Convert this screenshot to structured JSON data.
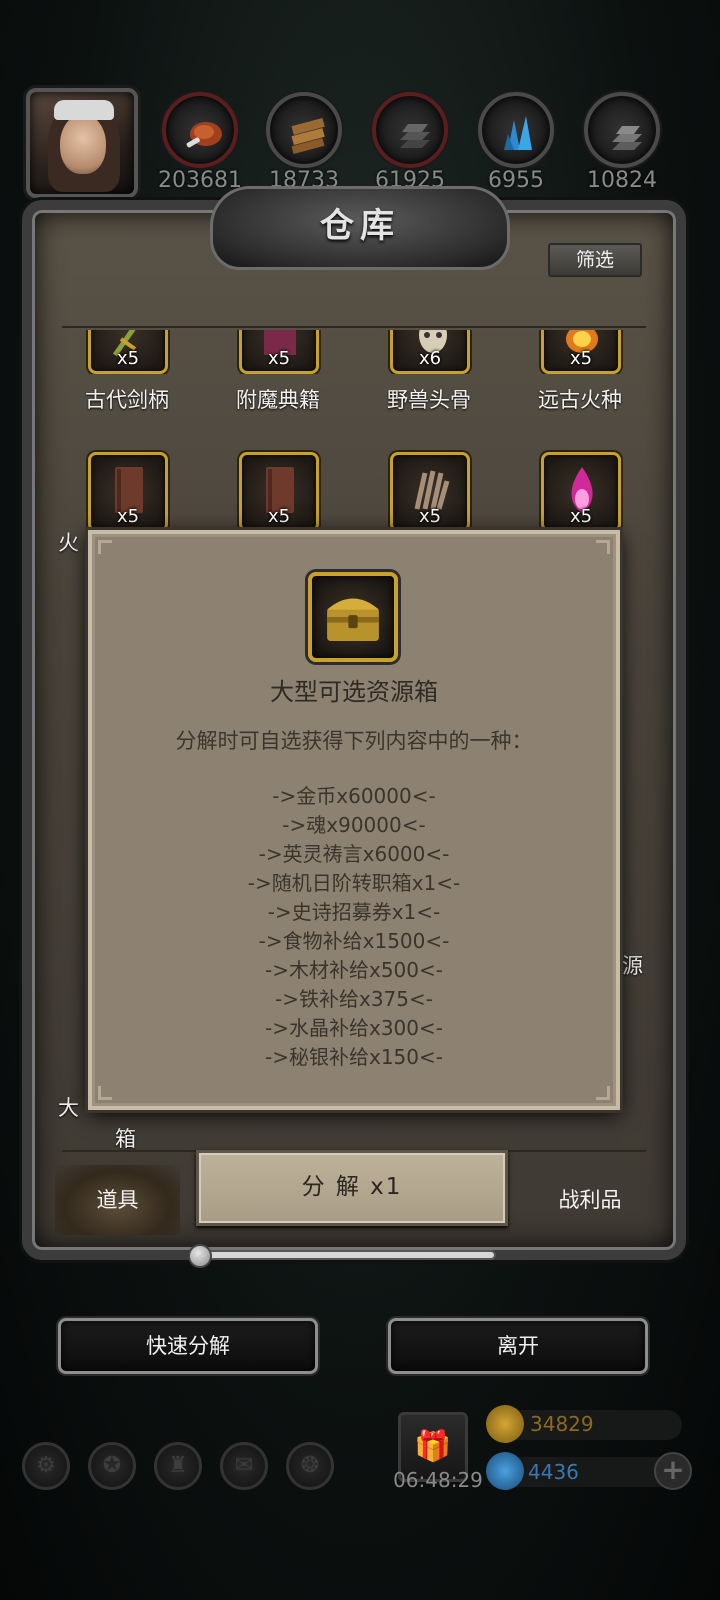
{
  "header": {
    "resources": [
      {
        "icon": "meat-icon",
        "value": "203681"
      },
      {
        "icon": "wood-icon",
        "value": "18733"
      },
      {
        "icon": "iron-icon",
        "value": "61925"
      },
      {
        "icon": "crystal-icon",
        "value": "6955"
      },
      {
        "icon": "mithril-icon",
        "value": "10824"
      }
    ]
  },
  "window": {
    "title": "仓库",
    "filter_label": "筛选",
    "items_row1": [
      {
        "name": "古代剑柄",
        "qty": "x5",
        "icon": "sword-hilt-icon"
      },
      {
        "name": "附魔典籍",
        "qty": "x5",
        "icon": "enchant-book-icon"
      },
      {
        "name": "野兽头骨",
        "qty": "x6",
        "icon": "beast-skull-icon"
      },
      {
        "name": "远古火种",
        "qty": "x5",
        "icon": "ancient-fire-icon"
      }
    ],
    "items_row2": [
      {
        "qty": "x5",
        "icon": "book-icon"
      },
      {
        "qty": "x5",
        "icon": "book-icon"
      },
      {
        "qty": "x5",
        "icon": "claw-icon"
      },
      {
        "qty": "x5",
        "icon": "pink-flame-icon"
      }
    ],
    "partial_left_1": "火",
    "partial_left_2": "大",
    "partial_left_3": "箱",
    "partial_right": "源",
    "tabs": {
      "left": "道具",
      "right": "战利品"
    },
    "decompose_label": "分 解 x1"
  },
  "modal": {
    "icon": "treasure-chest-icon",
    "title": "大型可选资源箱",
    "description": "分解时可自选获得下列内容中的一种：",
    "options": [
      "->金币x60000<-",
      "->魂x90000<-",
      "->英灵祷言x6000<-",
      "->随机日阶转职箱x1<-",
      "->史诗招募券x1<-",
      "->食物补给x1500<-",
      "->木材补给x500<-",
      "->铁补给x375<-",
      "->水晶补给x300<-",
      "->秘银补给x150<-"
    ]
  },
  "actions": {
    "quick_decompose": "快速分解",
    "leave": "离开"
  },
  "hud": {
    "time": "06:48:29",
    "gold": "34829",
    "gems": "4436",
    "colors": {
      "gold": "#b8860b",
      "gem": "#2e6fa8"
    }
  }
}
